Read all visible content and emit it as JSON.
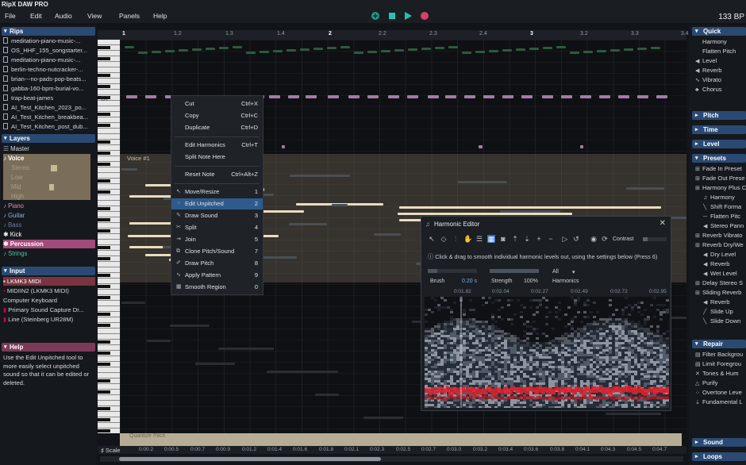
{
  "app": {
    "title": "RipX DAW PRO",
    "bpm": "133 BP"
  },
  "menu": [
    "File",
    "Edit",
    "Audio",
    "View",
    "Panels",
    "Help"
  ],
  "left": {
    "rips_title": "Rips",
    "rips": [
      "meditation-piano-music-...",
      "OS_HHF_155_songstarter...",
      "meditation-piano-music-...",
      "berlin-techno-nutcracker-...",
      "brian---no-pads-pop-beats...",
      "gabba-160-bpm-burial-vo...",
      "trap-beat-james",
      "AI_Test_Kitchen_2023_po...",
      "AI_Test_Kitchen_breakbea...",
      "AI_Test_Kitchen_post_dub..."
    ],
    "layers_title": "Layers",
    "layers": {
      "master": "Master",
      "voice": "Voice",
      "voice_sub": [
        "Stereo",
        "Low",
        "Mid",
        "High"
      ],
      "others": [
        "Piano",
        "Guitar",
        "Bass",
        "Kick"
      ],
      "percussion": "Percussion",
      "strings": "Strings"
    },
    "input_title": "Input",
    "inputs": [
      "LKMK3 MIDI",
      "MIDIIN2 (LKMK3 MIDI)",
      "Computer Keyboard",
      "Primary Sound Capture Dr...",
      "Line (Steinberg UR28M)"
    ],
    "help_title": "Help",
    "help_text": "Use the Edit Unpitched tool to more easily select unpitched sound so that it can be edited or deleted."
  },
  "ruler": [
    "1",
    "1.2",
    "1.3",
    "1.4",
    "2",
    "2.2",
    "2.3",
    "2.4",
    "3",
    "3.2",
    "3.3",
    "3.4"
  ],
  "editor": {
    "c7": "C7",
    "voice_label": "Voice #1",
    "pitch_strip": "Quantize Pitch"
  },
  "time_axis": [
    "0:00.2",
    "0:00.5",
    "0:00.7",
    "0:00.9",
    "0:01.2",
    "0:01.4",
    "0:01.6",
    "0:01.8",
    "0:02.1",
    "0:02.3",
    "0:02.5",
    "0:02.7",
    "0:03.0",
    "0:03.2",
    "0:03.4",
    "0:03.6",
    "0:03.8",
    "0:04.1",
    "0:04.3",
    "0:04.5",
    "0:04.7"
  ],
  "scale_label": "Scale",
  "context_menu": [
    {
      "label": "Cut",
      "key": "Ctrl+X"
    },
    {
      "label": "Copy",
      "key": "Ctrl+C"
    },
    {
      "label": "Duplicate",
      "key": "Ctrl+D"
    },
    {
      "label": "Edit Harmonics",
      "key": "Ctrl+T"
    },
    {
      "label": "Split Note Here",
      "key": ""
    },
    {
      "label": "Reset Note",
      "key": "Ctrl+Alt+Z"
    },
    {
      "label": "Move/Resize",
      "key": "1"
    },
    {
      "label": "Edit Unpitched",
      "key": "2"
    },
    {
      "label": "Draw Sound",
      "key": "3"
    },
    {
      "label": "Split",
      "key": "4"
    },
    {
      "label": "Join",
      "key": "5"
    },
    {
      "label": "Clone Pitch/Sound",
      "key": "7"
    },
    {
      "label": "Draw Pitch",
      "key": "8"
    },
    {
      "label": "Apply Pattern",
      "key": "9"
    },
    {
      "label": "Smooth Region",
      "key": "0"
    }
  ],
  "harmonic_editor": {
    "title": "Harmonic Editor",
    "contrast": "Contrast",
    "info": "Click & drag to smooth individual harmonic levels out, using the settings below (Press 6)",
    "brush_label": "Brush",
    "brush_value": "0.20 s",
    "strength_label": "Strength",
    "strength_value": "100%",
    "harmonics_value": "All",
    "harmonics_label": "Harmonics",
    "ruler": [
      "0:01.82",
      "0:02.04",
      "0:02.27",
      "0:02.49",
      "0:02.72",
      "0:02.95"
    ]
  },
  "right": {
    "quick_title": "Quick",
    "quick": [
      "Harmony",
      "Flatten Pitch",
      "Level",
      "Reverb",
      "Vibrato",
      "Chorus"
    ],
    "pitch_title": "Pitch",
    "time_title": "Time",
    "level_title": "Level",
    "presets_title": "Presets",
    "presets": [
      "Fade In Preset",
      "Fade Out Prese",
      "Harmony Plus C",
      "Harmony",
      "Shift Forma",
      "Flatten Pitc",
      "Stereo Pann",
      "Reverb Vibrato",
      "Reverb Dry/We",
      "Dry Level",
      "Reverb",
      "Wet Level",
      "Delay Stereo S",
      "Sliding Reverb",
      "Reverb",
      "Slide Up",
      "Slide Down"
    ],
    "repair_title": "Repair",
    "repair": [
      "Filter Backgrou",
      "Limit Foregrou",
      "Tones & Hum",
      "Purify",
      "Overtone Leve",
      "Fundamental L"
    ],
    "sound_title": "Sound",
    "loops_title": "Loops"
  }
}
